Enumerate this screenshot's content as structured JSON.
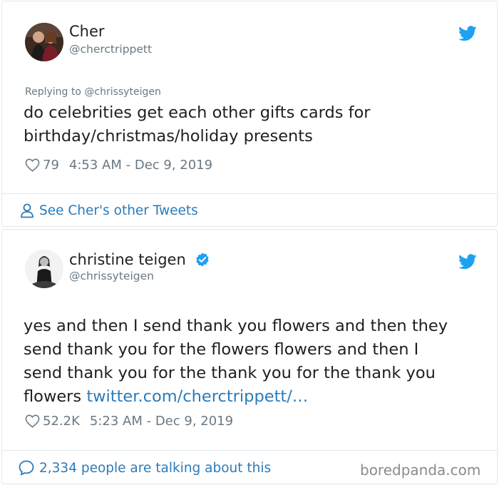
{
  "tweet1": {
    "author_name": "Cher",
    "author_handle": "@cherctrippett",
    "replying_to": "Replying to @chrissyteigen",
    "text_lines": [
      "do celebrities get each other gifts cards for",
      "birthday/christmas/holiday presents"
    ],
    "likes": "79",
    "timestamp": "4:53 AM - Dec 9, 2019",
    "footer_link": "See Cher's other Tweets"
  },
  "tweet2": {
    "author_name": "christine teigen",
    "author_handle": "@chrissyteigen",
    "text_lines": [
      "yes and then I send thank you flowers and then they",
      "send thank you for the flowers flowers and then I",
      "send thank you for the thank you for the thank you"
    ],
    "last_line_prefix": "flowers ",
    "link_text": "twitter.com/cherctrippett/…",
    "likes": "52.2K",
    "timestamp": "5:23 AM - Dec 9, 2019",
    "footer_link": "2,334 people are talking about this"
  },
  "watermark": "boredpanda.com",
  "icons": {
    "bird": "twitter-bird-icon",
    "heart": "heart-icon",
    "person": "person-icon",
    "comment": "comment-bubble-icon",
    "verified": "verified-badge-icon"
  },
  "colors": {
    "link_blue": "#2b7bb9",
    "bird_blue": "#1da1f2",
    "muted_gray": "#697882",
    "text": "#1c2022"
  }
}
